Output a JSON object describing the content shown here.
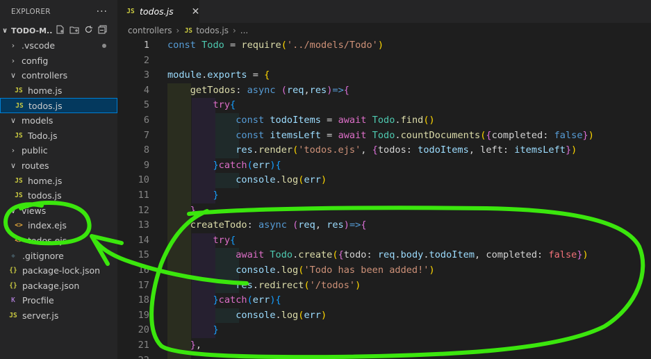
{
  "explorer": {
    "title": "EXPLORER",
    "more": "···",
    "project_name": "TODO-M...",
    "tree": [
      {
        "type": "folder",
        "label": ".vscode",
        "open": false,
        "depth": 0,
        "modified": true
      },
      {
        "type": "folder",
        "label": "config",
        "open": false,
        "depth": 0
      },
      {
        "type": "folder",
        "label": "controllers",
        "open": true,
        "depth": 0
      },
      {
        "type": "file",
        "label": "home.js",
        "icon": "JS",
        "kind": "js",
        "depth": 1
      },
      {
        "type": "file",
        "label": "todos.js",
        "icon": "JS",
        "kind": "js",
        "depth": 1,
        "selected": true
      },
      {
        "type": "folder",
        "label": "models",
        "open": true,
        "depth": 0
      },
      {
        "type": "file",
        "label": "Todo.js",
        "icon": "JS",
        "kind": "js",
        "depth": 1
      },
      {
        "type": "folder",
        "label": "public",
        "open": false,
        "depth": 0
      },
      {
        "type": "folder",
        "label": "routes",
        "open": true,
        "depth": 0
      },
      {
        "type": "file",
        "label": "home.js",
        "icon": "JS",
        "kind": "js",
        "depth": 1
      },
      {
        "type": "file",
        "label": "todos.js",
        "icon": "JS",
        "kind": "js",
        "depth": 1
      },
      {
        "type": "folder",
        "label": "views",
        "open": true,
        "depth": 0
      },
      {
        "type": "file",
        "label": "index.ejs",
        "icon": "<>",
        "kind": "ejs",
        "depth": 1
      },
      {
        "type": "file",
        "label": "todos.ejs",
        "icon": "<>",
        "kind": "ejs",
        "depth": 1
      },
      {
        "type": "file",
        "label": ".gitignore",
        "icon": "◆",
        "kind": "git",
        "depth": 0
      },
      {
        "type": "file",
        "label": "package-lock.json",
        "icon": "{}",
        "kind": "json",
        "depth": 0
      },
      {
        "type": "file",
        "label": "package.json",
        "icon": "{}",
        "kind": "json",
        "depth": 0
      },
      {
        "type": "file",
        "label": "Procfile",
        "icon": "K",
        "kind": "proc",
        "depth": 0
      },
      {
        "type": "file",
        "label": "server.js",
        "icon": "JS",
        "kind": "js",
        "depth": 0
      }
    ]
  },
  "tab": {
    "icon": "JS",
    "label": "todos.js",
    "close": "✕"
  },
  "breadcrumb": {
    "folder": "controllers",
    "icon": "JS",
    "file": "todos.js",
    "more": "..."
  },
  "editor": {
    "current_line": 1,
    "lines": [
      {
        "n": "1",
        "tokens": [
          [
            "const ",
            "kwb"
          ],
          [
            "Todo",
            "cls"
          ],
          [
            " = ",
            "op"
          ],
          [
            "require",
            "fn"
          ],
          [
            "(",
            "b1"
          ],
          [
            "'../models/Todo'",
            "str"
          ],
          [
            ")",
            "b1"
          ]
        ]
      },
      {
        "n": "2",
        "tokens": []
      },
      {
        "n": "3",
        "tokens": [
          [
            "module",
            "var"
          ],
          [
            ".",
            "op"
          ],
          [
            "exports",
            "var"
          ],
          [
            " = ",
            "op"
          ],
          [
            "{",
            "b1"
          ]
        ]
      },
      {
        "n": "4",
        "tokens": [
          [
            "    getTodos",
            "fn"
          ],
          [
            ": ",
            "op"
          ],
          [
            "async ",
            "kwb"
          ],
          [
            "(",
            "b2"
          ],
          [
            "req",
            "var"
          ],
          [
            ",",
            "op"
          ],
          [
            "res",
            "var"
          ],
          [
            ")",
            "b2"
          ],
          [
            "=>",
            "kwb"
          ],
          [
            "{",
            "b2"
          ]
        ]
      },
      {
        "n": "5",
        "tokens": [
          [
            "        try",
            "kw"
          ],
          [
            "{",
            "b3"
          ]
        ]
      },
      {
        "n": "6",
        "tokens": [
          [
            "            const ",
            "kwb"
          ],
          [
            "todoItems",
            "var"
          ],
          [
            " = ",
            "op"
          ],
          [
            "await ",
            "kw"
          ],
          [
            "Todo",
            "cls"
          ],
          [
            ".",
            "op"
          ],
          [
            "find",
            "fn"
          ],
          [
            "()",
            "b1"
          ]
        ]
      },
      {
        "n": "7",
        "tokens": [
          [
            "            const ",
            "kwb"
          ],
          [
            "itemsLeft",
            "var"
          ],
          [
            " = ",
            "op"
          ],
          [
            "await ",
            "kw"
          ],
          [
            "Todo",
            "cls"
          ],
          [
            ".",
            "op"
          ],
          [
            "countDocuments",
            "fn"
          ],
          [
            "(",
            "b1"
          ],
          [
            "{",
            "b2"
          ],
          [
            "completed: ",
            "op"
          ],
          [
            "false",
            "kwb"
          ],
          [
            "}",
            "b2"
          ],
          [
            ")",
            "b1"
          ]
        ]
      },
      {
        "n": "8",
        "tokens": [
          [
            "            res",
            "var"
          ],
          [
            ".",
            "op"
          ],
          [
            "render",
            "fn"
          ],
          [
            "(",
            "b1"
          ],
          [
            "'todos.ejs'",
            "str"
          ],
          [
            ", ",
            "op"
          ],
          [
            "{",
            "b2"
          ],
          [
            "todos: ",
            "op"
          ],
          [
            "todoItems",
            "var"
          ],
          [
            ", left: ",
            "op"
          ],
          [
            "itemsLeft",
            "var"
          ],
          [
            "}",
            "b2"
          ],
          [
            ")",
            "b1"
          ]
        ]
      },
      {
        "n": "9",
        "tokens": [
          [
            "        }",
            "b3"
          ],
          [
            "catch",
            "kw"
          ],
          [
            "(",
            "b3"
          ],
          [
            "err",
            "var"
          ],
          [
            ")",
            "b3"
          ],
          [
            "{",
            "b3"
          ]
        ]
      },
      {
        "n": "10",
        "tokens": [
          [
            "            console",
            "var"
          ],
          [
            ".",
            "op"
          ],
          [
            "log",
            "fn"
          ],
          [
            "(",
            "b1"
          ],
          [
            "err",
            "var"
          ],
          [
            ")",
            "b1"
          ]
        ]
      },
      {
        "n": "11",
        "tokens": [
          [
            "        }",
            "b3"
          ]
        ]
      },
      {
        "n": "12",
        "tokens": [
          [
            "    }",
            "b2"
          ],
          [
            ",",
            "op"
          ]
        ]
      },
      {
        "n": "13",
        "tokens": [
          [
            "    createTodo",
            "fn"
          ],
          [
            ": ",
            "op"
          ],
          [
            "async ",
            "kwb"
          ],
          [
            "(",
            "b2"
          ],
          [
            "req",
            "var"
          ],
          [
            ", ",
            "op"
          ],
          [
            "res",
            "var"
          ],
          [
            ")",
            "b2"
          ],
          [
            "=>",
            "kwb"
          ],
          [
            "{",
            "b2"
          ]
        ]
      },
      {
        "n": "14",
        "tokens": [
          [
            "        try",
            "kw"
          ],
          [
            "{",
            "b3"
          ]
        ]
      },
      {
        "n": "15",
        "tokens": [
          [
            "            await ",
            "kw"
          ],
          [
            "Todo",
            "cls"
          ],
          [
            ".",
            "op"
          ],
          [
            "create",
            "fn"
          ],
          [
            "(",
            "b1"
          ],
          [
            "{",
            "b2"
          ],
          [
            "todo: ",
            "op"
          ],
          [
            "req",
            "var"
          ],
          [
            ".",
            "op"
          ],
          [
            "body",
            "var"
          ],
          [
            ".",
            "op"
          ],
          [
            "todoItem",
            "var"
          ],
          [
            ", completed: ",
            "op"
          ],
          [
            "false",
            "bool"
          ],
          [
            "}",
            "b2"
          ],
          [
            ")",
            "b1"
          ]
        ]
      },
      {
        "n": "16",
        "tokens": [
          [
            "            console",
            "var"
          ],
          [
            ".",
            "op"
          ],
          [
            "log",
            "fn"
          ],
          [
            "(",
            "b1"
          ],
          [
            "'Todo has been added!'",
            "str"
          ],
          [
            ")",
            "b1"
          ]
        ]
      },
      {
        "n": "17",
        "tokens": [
          [
            "            res",
            "var"
          ],
          [
            ".",
            "op"
          ],
          [
            "redirect",
            "fn"
          ],
          [
            "(",
            "b1"
          ],
          [
            "'/todos'",
            "str"
          ],
          [
            ")",
            "b1"
          ]
        ]
      },
      {
        "n": "18",
        "tokens": [
          [
            "        }",
            "b3"
          ],
          [
            "catch",
            "kw"
          ],
          [
            "(",
            "b3"
          ],
          [
            "err",
            "var"
          ],
          [
            ")",
            "b3"
          ],
          [
            "{",
            "b3"
          ]
        ]
      },
      {
        "n": "19",
        "tokens": [
          [
            "            console",
            "var"
          ],
          [
            ".",
            "op"
          ],
          [
            "log",
            "fn"
          ],
          [
            "(",
            "b1"
          ],
          [
            "err",
            "var"
          ],
          [
            ")",
            "b1"
          ]
        ]
      },
      {
        "n": "20",
        "tokens": [
          [
            "        }",
            "b3"
          ]
        ]
      },
      {
        "n": "21",
        "tokens": [
          [
            "    }",
            "b2"
          ],
          [
            ",",
            "op"
          ]
        ]
      },
      {
        "n": "22",
        "tokens": [
          [
            "    ",
            "op"
          ]
        ]
      }
    ]
  },
  "colors": {
    "annotation": "#3be60d",
    "selection": "#04395e",
    "focus_border": "#007fd4"
  }
}
